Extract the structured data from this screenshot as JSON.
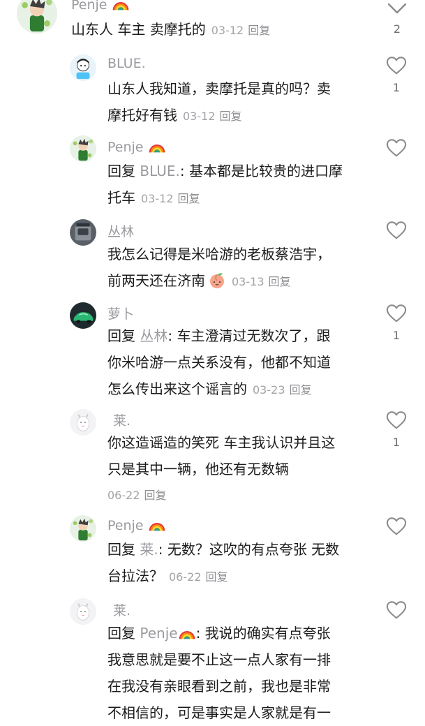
{
  "comments": [
    {
      "id": "c0",
      "user": "Penje",
      "rainbow": true,
      "line1": "山东人 车主 卖摩托的",
      "line2": "",
      "date": "03-12",
      "reply": "回复",
      "likes": "2"
    },
    {
      "id": "c1",
      "user": "BLUE.",
      "line1": "山东人我知道，卖摩托是真的吗？卖",
      "line2": "摩托好有钱",
      "date": "03-12",
      "reply": "回复",
      "likes": "1"
    },
    {
      "id": "c2",
      "user": "Penje",
      "rainbow": true,
      "prefix": "回复",
      "ref": "BLUE.",
      "line1rest": ": 基本都是比较贵的进口摩",
      "line2": "托车",
      "date": "03-12",
      "reply": "回复",
      "likes": ""
    },
    {
      "id": "c3",
      "user": "丛林",
      "line1": "我怎么记得是米哈游的老板蔡浩宇，",
      "line2": "前两天还在济南",
      "date": "03-13",
      "reply": "回复",
      "likes": ""
    },
    {
      "id": "c4",
      "user": "萝卜",
      "prefix": "回复",
      "ref": "丛林",
      "line1rest": ": 车主澄清过无数次了，跟",
      "line2": "你米哈游一点关系没有，他都不知道",
      "line3": "怎么传出来这个谣言的",
      "date": "03-23",
      "reply": "回复",
      "likes": "1"
    },
    {
      "id": "c5",
      "user": "莱.",
      "line1": "你这造谣造的笑死 车主我认识并且这",
      "line2": "只是其中一辆，他还有无数辆",
      "date": "06-22",
      "reply": "回复",
      "likes": "1"
    },
    {
      "id": "c6",
      "user": "Penje",
      "rainbow": true,
      "prefix": "回复",
      "ref": "莱.",
      "line1rest": ": 无数？这吹的有点夸张 无数",
      "line2": "台拉法？",
      "date": "06-22",
      "reply": "回复",
      "likes": ""
    },
    {
      "id": "c7",
      "user": "莱.",
      "prefix": "回复",
      "ref": "Penje",
      "refRainbow": true,
      "line1rest": ": 我说的确实有点夸张",
      "line2": "我意思就是要不止这一点人家有一排",
      "line3": "在我没有亲眼看到之前，我也是非常",
      "line4": "不相信的，可是事实是人家就是有一",
      "likes": ""
    }
  ],
  "icons": {
    "like": "heart-outline-icon",
    "rainbow": "rainbow-emoji-icon",
    "peach": "peach-emoji-icon",
    "collapse": "chevron-down-icon"
  },
  "colors": {
    "meta": "#a3a3a8",
    "username": "#9a9aa0",
    "text": "#1b1b1b"
  }
}
